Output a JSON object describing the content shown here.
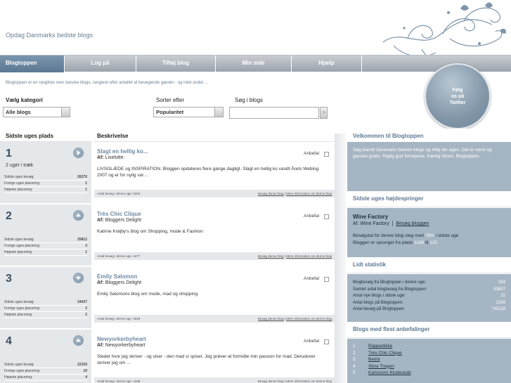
{
  "header": {
    "tagline": "Opdag Danmarks bedste blogs"
  },
  "nav": {
    "items": [
      {
        "label": "Blogtoppen",
        "active": true
      },
      {
        "label": "Log på"
      },
      {
        "label": "Tilføj blog"
      },
      {
        "label": "Min side"
      },
      {
        "label": "Hjælp"
      }
    ]
  },
  "twitter": {
    "line1": "Følg",
    "line2": "os på",
    "line3": "Twitter"
  },
  "intro": "Blogtoppen er en rangliste over danske blogs, rangeret efter antallet af besøgende gæster - og intet andet ...",
  "filters": {
    "category_label": "Vælg kategori",
    "category_value": "Alle blogs",
    "sort_label": "Sorter efter",
    "sort_value": "Popularitet",
    "search_label": "Søg i blogs",
    "search_button": ">"
  },
  "columns": {
    "rank": "Sidste uges plads",
    "description": "Beskrivelse"
  },
  "stat_labels": {
    "visits": "Sidste uges besøg:",
    "prev": "Forrige uges placering:",
    "best": "Højeste placering:"
  },
  "blog_labels": {
    "author_prefix": "Af:",
    "recommend": "Anbefal",
    "visits_prefix": "Antal besøg i denne uge:",
    "visit_link": "Besøg denne blog",
    "sep": " | ",
    "info_link": "Mere information om denne blog"
  },
  "ranks": [
    {
      "num": "1",
      "arrow": "right",
      "sub": "2 uger i træk",
      "visits": "26276",
      "prev": "1",
      "best": "1"
    },
    {
      "num": "2",
      "arrow": "up",
      "sub": "",
      "visits": "25812",
      "prev": "3",
      "best": "1"
    },
    {
      "num": "3",
      "arrow": "down",
      "sub": "",
      "visits": "24437",
      "prev": "2",
      "best": "2"
    },
    {
      "num": "4",
      "arrow": "up",
      "sub": "",
      "visits": "22159",
      "prev": "10",
      "best": "4"
    }
  ],
  "blogs": [
    {
      "title": "Slagt en hellig ko...",
      "author": "Liselotte",
      "desc": "LIVSGLÆDE og INSPIRATION. Bloggen opdateres flere gange dagligt. Slagt en hellig ko vandt Årets Weblog 2007 og er for nylig val ...",
      "visits": "5202"
    },
    {
      "title": "Très Chic Clique",
      "author": "Bloggers Delight",
      "desc": "Katrine Krøjby's blog om Shopping, mode & Fashion",
      "visits": "4477"
    },
    {
      "title": "Emily Salomon",
      "author": "Bloggers Delight",
      "desc": "Emily Salomons blog om mode, mad og shopping",
      "visits": "4529"
    },
    {
      "title": "Newyorkerbyheart",
      "author": "Newyorkerbyheart",
      "desc": "Stedet hvor jeg skriver - og viser - den mad vi spiser. Jeg prøver at formidle min passion for mad. Derudover skriver jeg om ...",
      "visits": "4348"
    }
  ],
  "sidebar": {
    "welcome_title": "Velkommen til Blogtoppen",
    "welcome_text": "Søg blandt Danmarks bedste blogs og tilføj din egen. Det er nemt og ganske gratis. Rigtig god fornøjelse. Kærlig hilsen, Blogtoppen.",
    "jumper_title": "Sidste uges højdespringer",
    "jumper": {
      "name": "Wine Factory",
      "author_prefix": "Af:",
      "author": "Wine Factory",
      "sep": "|",
      "visit_link": "Besøg bloggen",
      "line1_pre": "Besøgstal for denne blog steg med",
      "line1_pct": "78%",
      "line1_post": "i sidste uge",
      "line2_pre": "Bloggen er sprunget fra plads",
      "line2_from": "1169",
      "line2_mid": "til",
      "line2_to": "115"
    },
    "stats_title": "Lidt statistik",
    "stats": [
      {
        "label": "Blogbesøg fra Blogtoppen i denne uge:",
        "value": "263"
      },
      {
        "label": "Samlet antal blogbesøg fra Blogtoppen:",
        "value": "83807"
      },
      {
        "label": "Antal nye blogs i sidste uge:",
        "value": "22"
      },
      {
        "label": "Antal blogs på Blogtoppen:",
        "value": "1329"
      },
      {
        "label": "Antal besøg på Blogtoppen:",
        "value": "745119"
      }
    ],
    "rec_title": "Blogs med flest anbefalinger",
    "recs": [
      {
        "n": "1",
        "name": "Rappedikke"
      },
      {
        "n": "2",
        "name": "Très Chic Clique"
      },
      {
        "n": "3",
        "name": "Bedst"
      },
      {
        "n": "4",
        "name": "Stine Tregen"
      },
      {
        "n": "5",
        "name": "Karlssons Kludeskab"
      }
    ]
  },
  "colors": {
    "accent": "#6e8aa4",
    "nav": "#9ba3ab",
    "sidebar_box": "#a6b5c3"
  }
}
